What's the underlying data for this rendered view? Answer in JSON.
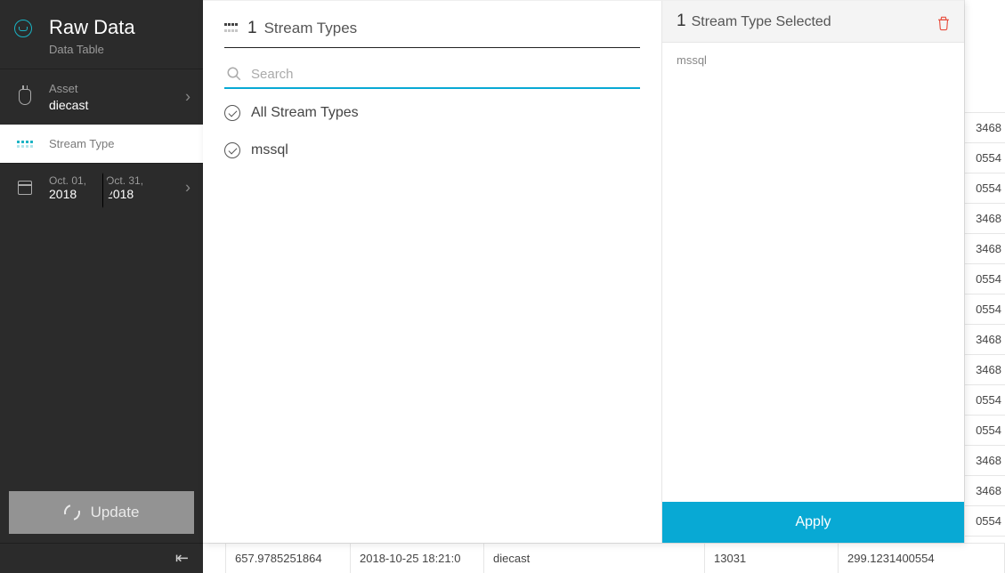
{
  "sidebar": {
    "title": "Raw Data",
    "subtitle": "Data Table",
    "asset": {
      "label": "Asset",
      "value": "diecast"
    },
    "stream_type": {
      "label": "Stream Type"
    },
    "date_range": {
      "from_top": "Oct. 01,",
      "from_bottom": "2018",
      "to_top": "Oct. 31,",
      "to_bottom": "2018"
    },
    "update_label": "Update"
  },
  "popover": {
    "header_count": "1",
    "header_label": "Stream Types",
    "search_placeholder": "Search",
    "items": {
      "all": "All Stream Types",
      "mssql": "mssql"
    },
    "selected_count": "1",
    "selected_label": "Stream Type Selected",
    "selected_item": "mssql",
    "apply_label": "Apply"
  },
  "background": {
    "right_values": [
      "3468",
      "0554",
      "0554",
      "3468",
      "3468",
      "0554",
      "0554",
      "3468",
      "3468",
      "0554",
      "0554",
      "3468",
      "3468",
      "0554"
    ],
    "bottom_row": {
      "c1": "657.9785251864",
      "c2": "2018-10-25 18:21:0",
      "c3": "diecast",
      "c4": "13031",
      "c5": "299.1231400554"
    }
  }
}
